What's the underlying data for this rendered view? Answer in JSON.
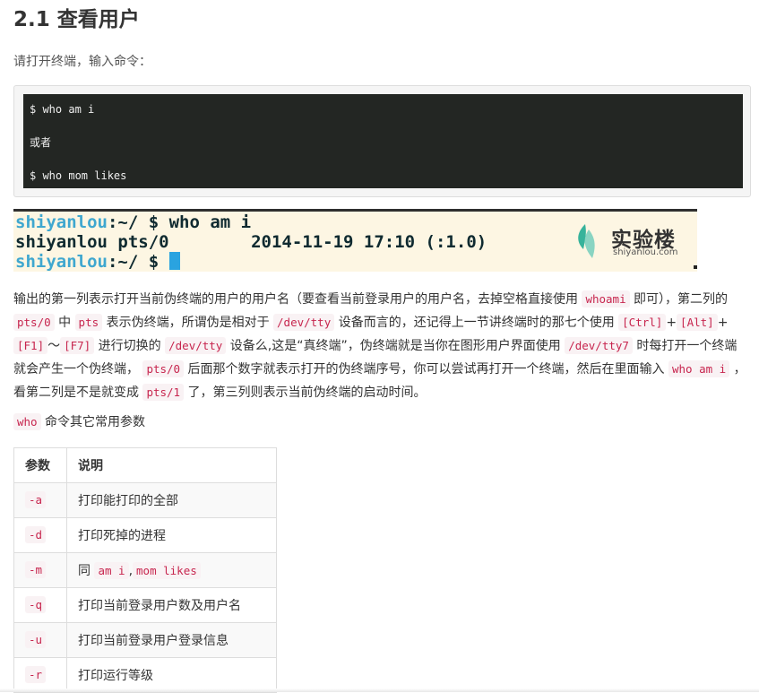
{
  "heading": "2.1 查看用户",
  "intro": "请打开终端，输入命令：",
  "code_block": {
    "line1": "$ who am i",
    "line2": "或者",
    "line3": "$ who mom likes"
  },
  "terminal": {
    "line1_user": "shiyanlou",
    "line1_rest": ":~/ $ who am i",
    "line2": "shiyanlou pts/0        2014-11-19 17:10 (:1.0)",
    "line3_user": "shiyanlou",
    "line3_rest": ":~/ $ ",
    "logo_text": "实验楼",
    "logo_url": "shiyanlou.com"
  },
  "paragraph": {
    "t1": "输出的第一列表示打开当前伪终端的用户的用户名（要查看当前登录用户的用户名，去掉空格直接使用 ",
    "c1": "whoami",
    "t2": " 即可），第二列的 ",
    "c2": "pts/0",
    "t3": " 中 ",
    "c3": "pts",
    "t4": " 表示伪终端，所谓伪是相对于 ",
    "c4": "/dev/tty",
    "t5": " 设备而言的，还记得上一节讲终端时的那七个使用 ",
    "c5": "[Ctrl]",
    "t6": "+",
    "c6": "[Alt]",
    "t7": "+",
    "c7": "[F1]",
    "t8": "～",
    "c8": "[F7]",
    "t9": " 进行切换的 ",
    "c9": "/dev/tty",
    "t10": " 设备么,这是“真终端”，伪终端就是当你在图形用户界面使用 ",
    "c10": "/dev/tty7",
    "t11": " 时每打开一个终端就会产生一个伪终端， ",
    "c11": "pts/0",
    "t12": " 后面那个数字就表示打开的伪终端序号，你可以尝试再打开一个终端，然后在里面输入 ",
    "c12": "who am i",
    "t13": " ，看第二列是不是就变成 ",
    "c13": "pts/1",
    "t14": " 了，第三列则表示当前伪终端的启动时间。"
  },
  "who_line": {
    "code": "who",
    "text": " 命令其它常用参数"
  },
  "table": {
    "headers": [
      "参数",
      "说明"
    ],
    "rows": [
      {
        "param": "-a",
        "desc": "打印能打印的全部"
      },
      {
        "param": "-d",
        "desc": "打印死掉的进程"
      },
      {
        "param": "-m",
        "desc_prefix": "同 ",
        "desc_code1": "am i",
        "desc_sep": ",",
        "desc_code2": "mom likes"
      },
      {
        "param": "-q",
        "desc": "打印当前登录用户数及用户名"
      },
      {
        "param": "-u",
        "desc": "打印当前登录用户登录信息"
      },
      {
        "param": "-r",
        "desc": "打印运行等级"
      }
    ]
  }
}
